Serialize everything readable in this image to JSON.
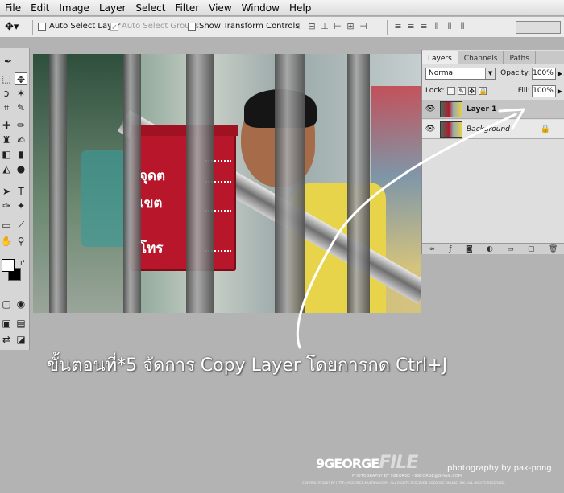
{
  "menubar": {
    "items": [
      "File",
      "Edit",
      "Image",
      "Layer",
      "Select",
      "Filter",
      "View",
      "Window",
      "Help"
    ]
  },
  "options": {
    "auto_select_layer": "Auto Select Layer",
    "auto_select_groups": "Auto Select Groups",
    "show_transform_controls": "Show Transform Controls"
  },
  "sign": {
    "line1": "จุดต",
    "line2": "เขต",
    "line3": "โทร"
  },
  "layers_panel": {
    "tabs": [
      "Layers",
      "Channels",
      "Paths"
    ],
    "blend_mode": "Normal",
    "opacity_label": "Opacity:",
    "opacity_value": "100%",
    "lock_label": "Lock:",
    "fill_label": "Fill:",
    "fill_value": "100%",
    "layers": [
      {
        "name": "Layer 1",
        "selected": true
      },
      {
        "name": "Background",
        "selected": false
      }
    ]
  },
  "caption": "ขั้นตอนที่*5 จัดการ Copy Layer โดยการกด Ctrl+J",
  "watermark": {
    "logo_a": "9GEORGE",
    "logo_b": "FILE",
    "credit": "photography by pak-pong",
    "sub": "PHOTOGRAPHY BY 9GEORGE - 9GEORGE@GMAIL.COM",
    "copyright": "COPYRIGHT 2007 BY HTTP://9GEORGE.MULTIPLY.COM - ALL RIGHTS RESERVED 9GEORGE ONLINE, INC. ALL RIGHTS RESERVED."
  },
  "colors": {
    "accent_sign": "#b8162a",
    "shirt": "#e7d44b"
  }
}
